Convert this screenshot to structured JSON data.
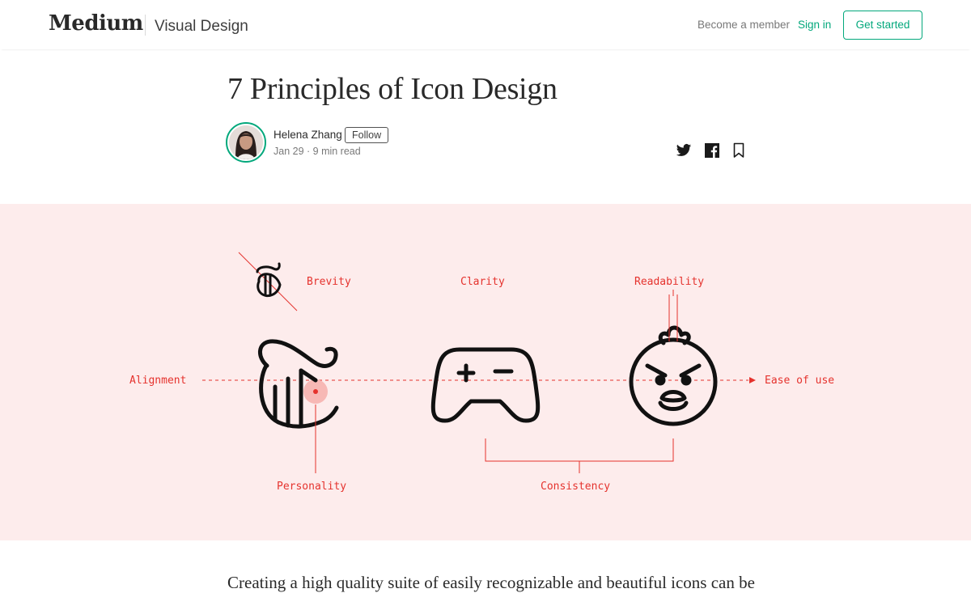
{
  "header": {
    "logo": "Medium",
    "publication": "Visual Design",
    "become_member": "Become a member",
    "sign_in": "Sign in",
    "get_started": "Get started"
  },
  "article": {
    "title": "7 Principles of Icon Design",
    "author": "Helena Zhang",
    "follow": "Follow",
    "meta": "Jan 29 · 9 min read",
    "body_start": "Creating a high quality suite of easily recognizable and beautiful icons can be"
  },
  "share_icons": [
    "twitter-icon",
    "facebook-icon",
    "bookmark-icon"
  ],
  "hero": {
    "labels": {
      "brevity": "Brevity",
      "clarity": "Clarity",
      "readability": "Readability",
      "alignment": "Alignment",
      "ease": "Ease of use",
      "personality": "Personality",
      "consistency": "Consistency"
    },
    "icons": [
      "nyt-logo-icon",
      "gamepad-icon",
      "angry-chick-icon"
    ]
  },
  "colors": {
    "accent_green": "#03a87c",
    "hero_bg": "#fdecec",
    "annotation_red": "#e5322d"
  }
}
